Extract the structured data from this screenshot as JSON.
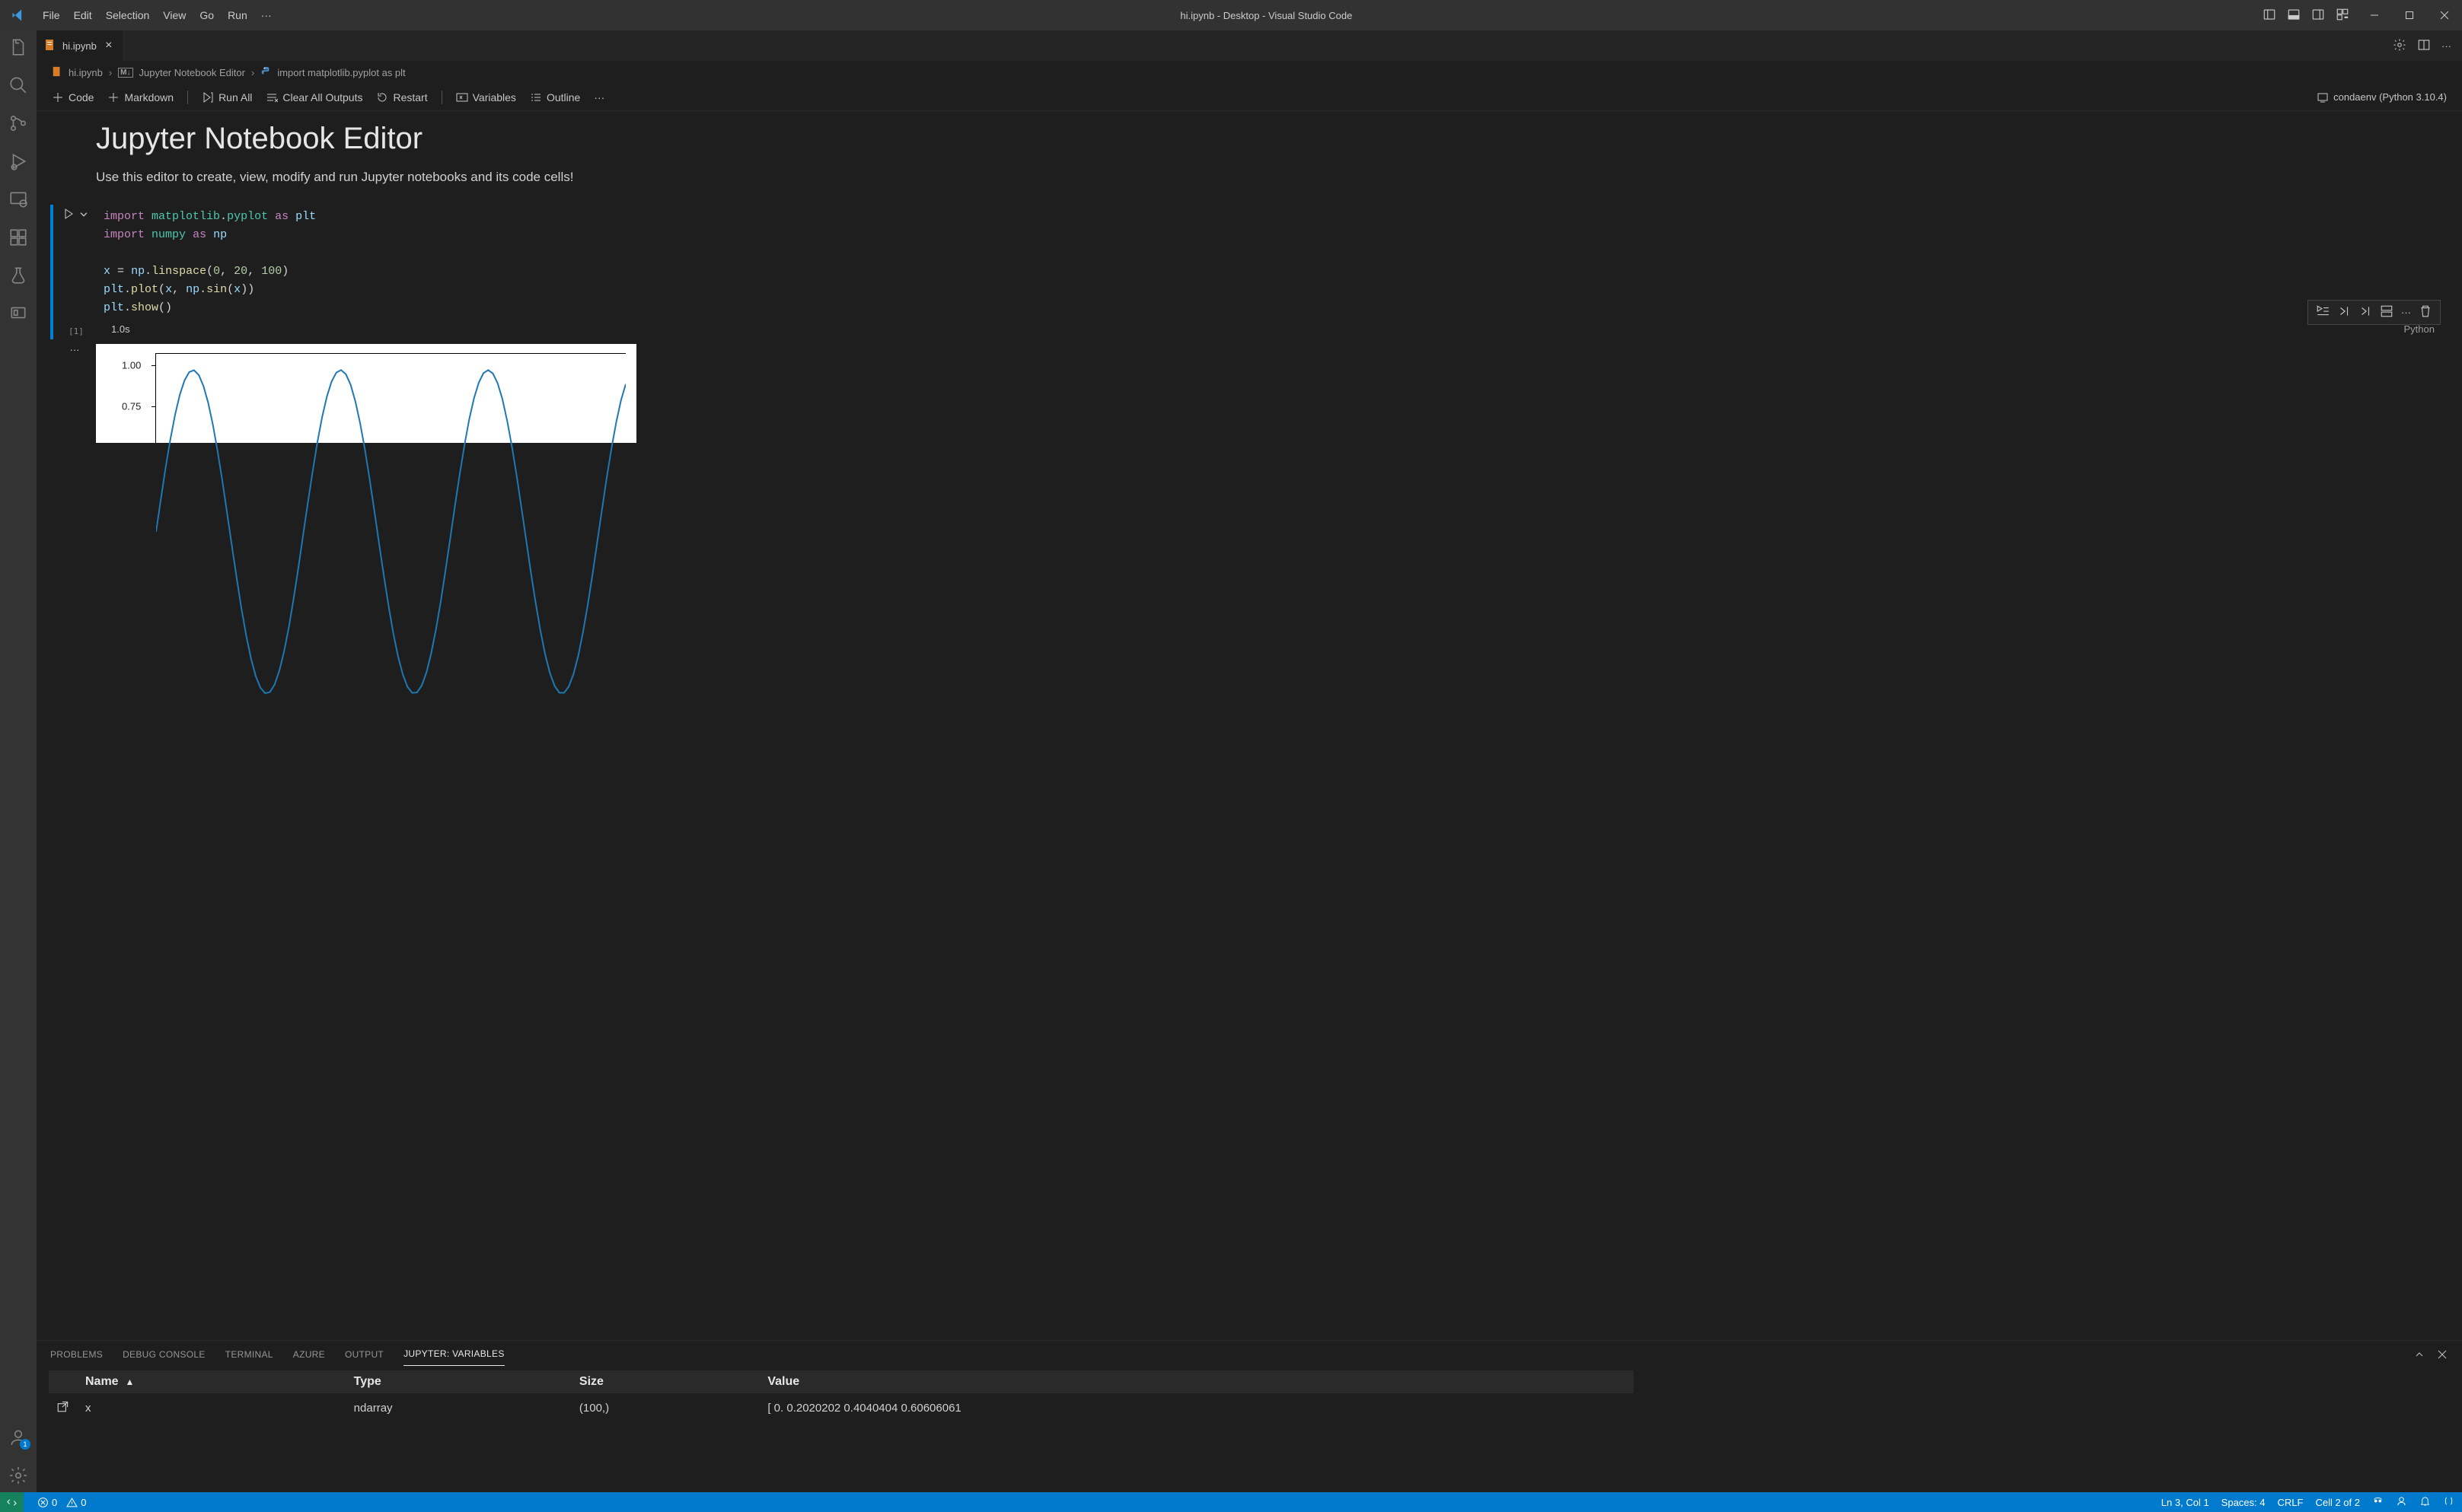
{
  "window": {
    "title": "hi.ipynb - Desktop - Visual Studio Code",
    "menus": [
      "File",
      "Edit",
      "Selection",
      "View",
      "Go",
      "Run"
    ]
  },
  "tab": {
    "label": "hi.ipynb"
  },
  "breadcrumb": {
    "file": "hi.ipynb",
    "section": "Jupyter Notebook Editor",
    "symbol": "import matplotlib.pyplot as plt"
  },
  "nb_toolbar": {
    "code": "Code",
    "markdown": "Markdown",
    "run_all": "Run All",
    "clear_outputs": "Clear All Outputs",
    "restart": "Restart",
    "variables": "Variables",
    "outline": "Outline",
    "kernel": "condaenv (Python 3.10.4)"
  },
  "markdown": {
    "title": "Jupyter Notebook Editor",
    "body": "Use this editor to create, view, modify and run Jupyter notebooks and its code cells!"
  },
  "code_cell": {
    "exec_count": "[1]",
    "code_lines": [
      "import matplotlib.pyplot as plt",
      "import numpy as np",
      "",
      "x = np.linspace(0, 20, 100)",
      "plt.plot(x, np.sin(x))",
      "plt.show()"
    ],
    "status_time": "1.0s",
    "language": "Python"
  },
  "chart_data": {
    "type": "line",
    "title": "",
    "xlabel": "",
    "ylabel": "",
    "y_ticks_visible": [
      "1.00",
      "0.75"
    ],
    "ylim": [
      -1.1,
      1.1
    ],
    "xlim": [
      0,
      20
    ],
    "series": [
      {
        "name": "sin(x)",
        "x": [
          0,
          0.2020202,
          0.4040404,
          0.60606061,
          0.80808081,
          1.01010101,
          1.21212121,
          1.41414141,
          1.61616162,
          1.81818182,
          2.02020202,
          2.22222222,
          2.42424242,
          2.62626263,
          2.82828283,
          3.03030303,
          3.23232323,
          3.43434343,
          3.63636364,
          3.83838384,
          4.04040404,
          4.24242424,
          4.44444444,
          4.64646465,
          4.84848485,
          5.05050505,
          5.25252525,
          5.45454545,
          5.65656566,
          5.85858586,
          6.06060606,
          6.26262626,
          6.46464646,
          6.66666667,
          6.86868687,
          7.07070707,
          7.27272727,
          7.47474747,
          7.67676768,
          7.87878788,
          8.08080808,
          8.28282828,
          8.48484848,
          8.68686869,
          8.88888889,
          9.09090909,
          9.29292929,
          9.49494949,
          9.6969697,
          9.8989899,
          10.1010101,
          10.3030303,
          10.50505051,
          10.70707071,
          10.90909091,
          11.11111111,
          11.31313131,
          11.51515152,
          11.71717172,
          11.91919192,
          12.12121212,
          12.32323232,
          12.52525253,
          12.72727273,
          12.92929293,
          13.13131313,
          13.33333333,
          13.53535354,
          13.73737374,
          13.93939394,
          14.14141414,
          14.34343434,
          14.54545455,
          14.74747475,
          14.94949495,
          15.15151515,
          15.35353535,
          15.55555556,
          15.75757576,
          15.95959596,
          16.16161616,
          16.36363636,
          16.56565657,
          16.76767677,
          16.96969697,
          17.17171717,
          17.37373737,
          17.57575758,
          17.77777778,
          17.97979798,
          18.18181818,
          18.38383838,
          18.58585859,
          18.78787879,
          18.98989899,
          19.19191919,
          19.39393939,
          19.5959596,
          19.7979798,
          20
        ],
        "y_expr": "sin(x)"
      }
    ]
  },
  "panel": {
    "tabs": [
      "PROBLEMS",
      "DEBUG CONSOLE",
      "TERMINAL",
      "AZURE",
      "OUTPUT",
      "JUPYTER: VARIABLES"
    ],
    "active_tab": "JUPYTER: VARIABLES",
    "columns": [
      "Name",
      "Type",
      "Size",
      "Value"
    ],
    "rows": [
      {
        "name": "x",
        "type": "ndarray",
        "size": "(100,)",
        "value": "[ 0.          0.2020202   0.4040404   0.60606061"
      }
    ]
  },
  "statusbar": {
    "errors": "0",
    "warnings": "0",
    "ln_col": "Ln 3, Col 1",
    "spaces": "Spaces: 4",
    "eol": "CRLF",
    "cell": "Cell 2 of 2"
  },
  "activity_badge": "1"
}
